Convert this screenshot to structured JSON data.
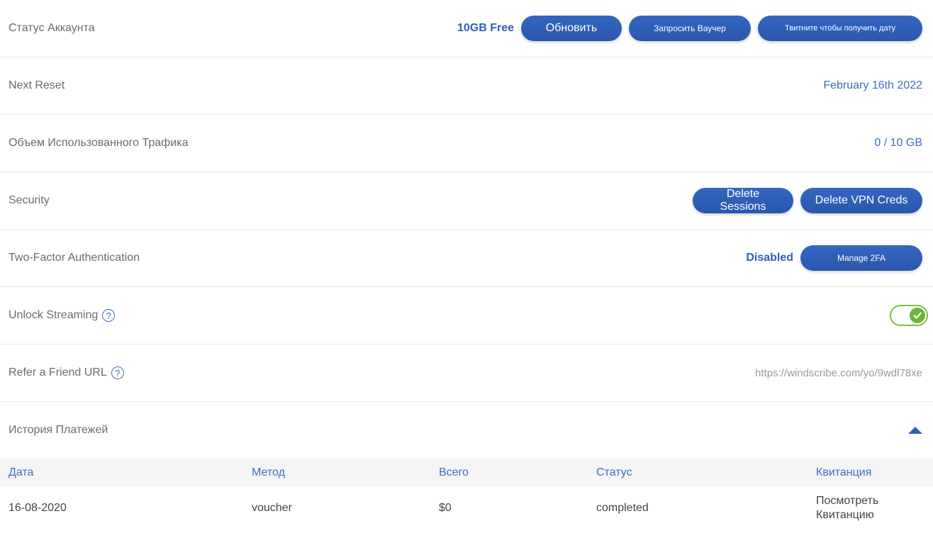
{
  "account_status": {
    "label": "Статус Аккаунта",
    "plan": "10GB Free",
    "upgrade_label": "Обновить",
    "voucher_label": "Запросить Ваучер",
    "tweet_label": "Твитните чтобы получить дату"
  },
  "next_reset": {
    "label": "Next Reset",
    "value": "February 16th 2022"
  },
  "traffic": {
    "label": "Объем Использованного Трафика",
    "value": "0 / 10 GB"
  },
  "security": {
    "label": "Security",
    "delete_sessions_label": "Delete Sessions",
    "delete_vpn_creds_label": "Delete VPN Creds"
  },
  "two_factor": {
    "label": "Two-Factor Authentication",
    "status": "Disabled",
    "manage_label": "Manage 2FA"
  },
  "unlock_streaming": {
    "label": "Unlock Streaming",
    "help": "?",
    "enabled": true
  },
  "refer": {
    "label": "Refer a Friend URL",
    "help": "?",
    "url": "https://windscribe.com/yo/9wdl78xe"
  },
  "payment_history": {
    "label": "История Платежей",
    "columns": [
      "Дата",
      "Метод",
      "Всего",
      "Статус",
      "Квитанция"
    ],
    "rows": [
      {
        "date": "16-08-2020",
        "method": "voucher",
        "total": "$0",
        "status": "completed",
        "receipt": "Посмотреть Квитанцию"
      }
    ]
  },
  "colors": {
    "accent": "#2f5fb9",
    "link": "#3e6cc4",
    "toggle_on": "#7ac143"
  }
}
